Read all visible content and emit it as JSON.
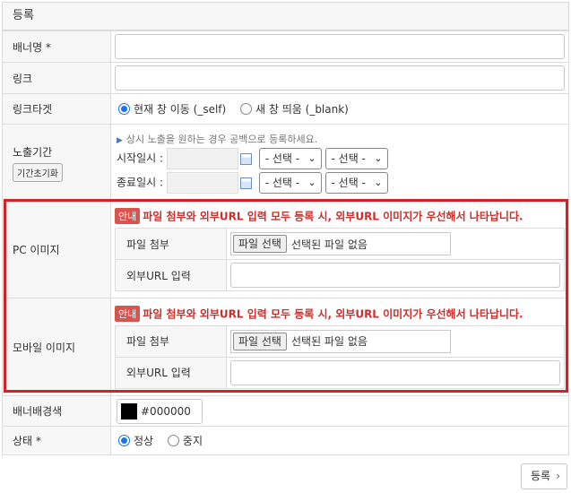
{
  "section_title": "등록",
  "banner_name": {
    "label": "배너명 *",
    "value": ""
  },
  "link": {
    "label": "링크",
    "value": ""
  },
  "link_target": {
    "label": "링크타겟",
    "options": [
      {
        "label": "현재 창 이동 (_self)",
        "selected": true
      },
      {
        "label": "새 창 띄움 (_blank)",
        "selected": false
      }
    ]
  },
  "exposure": {
    "label": "노출기간",
    "reset_button": "기간초기화",
    "hint": "상시 노출을 원하는 경우 공백으로 등록하세요.",
    "start_label": "시작일시 :",
    "end_label": "종료일시 :",
    "select_placeholder": "- 선택 -"
  },
  "pc_image": {
    "label": "PC 이미지",
    "notice_tag": "안내",
    "notice": "파일 첨부와 외부URL 입력 모두 등록 시, 외부URL 이미지가 우선해서 나타납니다.",
    "file_label": "파일 첨부",
    "file_button": "파일 선택",
    "file_status": "선택된 파일 없음",
    "url_label": "외부URL 입력",
    "url_value": ""
  },
  "mobile_image": {
    "label": "모바일 이미지",
    "notice_tag": "안내",
    "notice": "파일 첨부와 외부URL 입력 모두 등록 시, 외부URL 이미지가 우선해서 나타납니다.",
    "file_label": "파일 첨부",
    "file_button": "파일 선택",
    "file_status": "선택된 파일 없음",
    "url_label": "외부URL 입력",
    "url_value": ""
  },
  "bg_color": {
    "label": "배너배경색",
    "value": "#000000",
    "swatch": "#000000"
  },
  "status": {
    "label": "상태 *",
    "options": [
      {
        "label": "정상",
        "selected": true
      },
      {
        "label": "중지",
        "selected": false
      }
    ]
  },
  "submit": {
    "label": "등록",
    "arrow": "›"
  },
  "colors": {
    "accent": "#1a73e8",
    "notice": "#c9302c",
    "highlight_frame": "#d3212a"
  }
}
